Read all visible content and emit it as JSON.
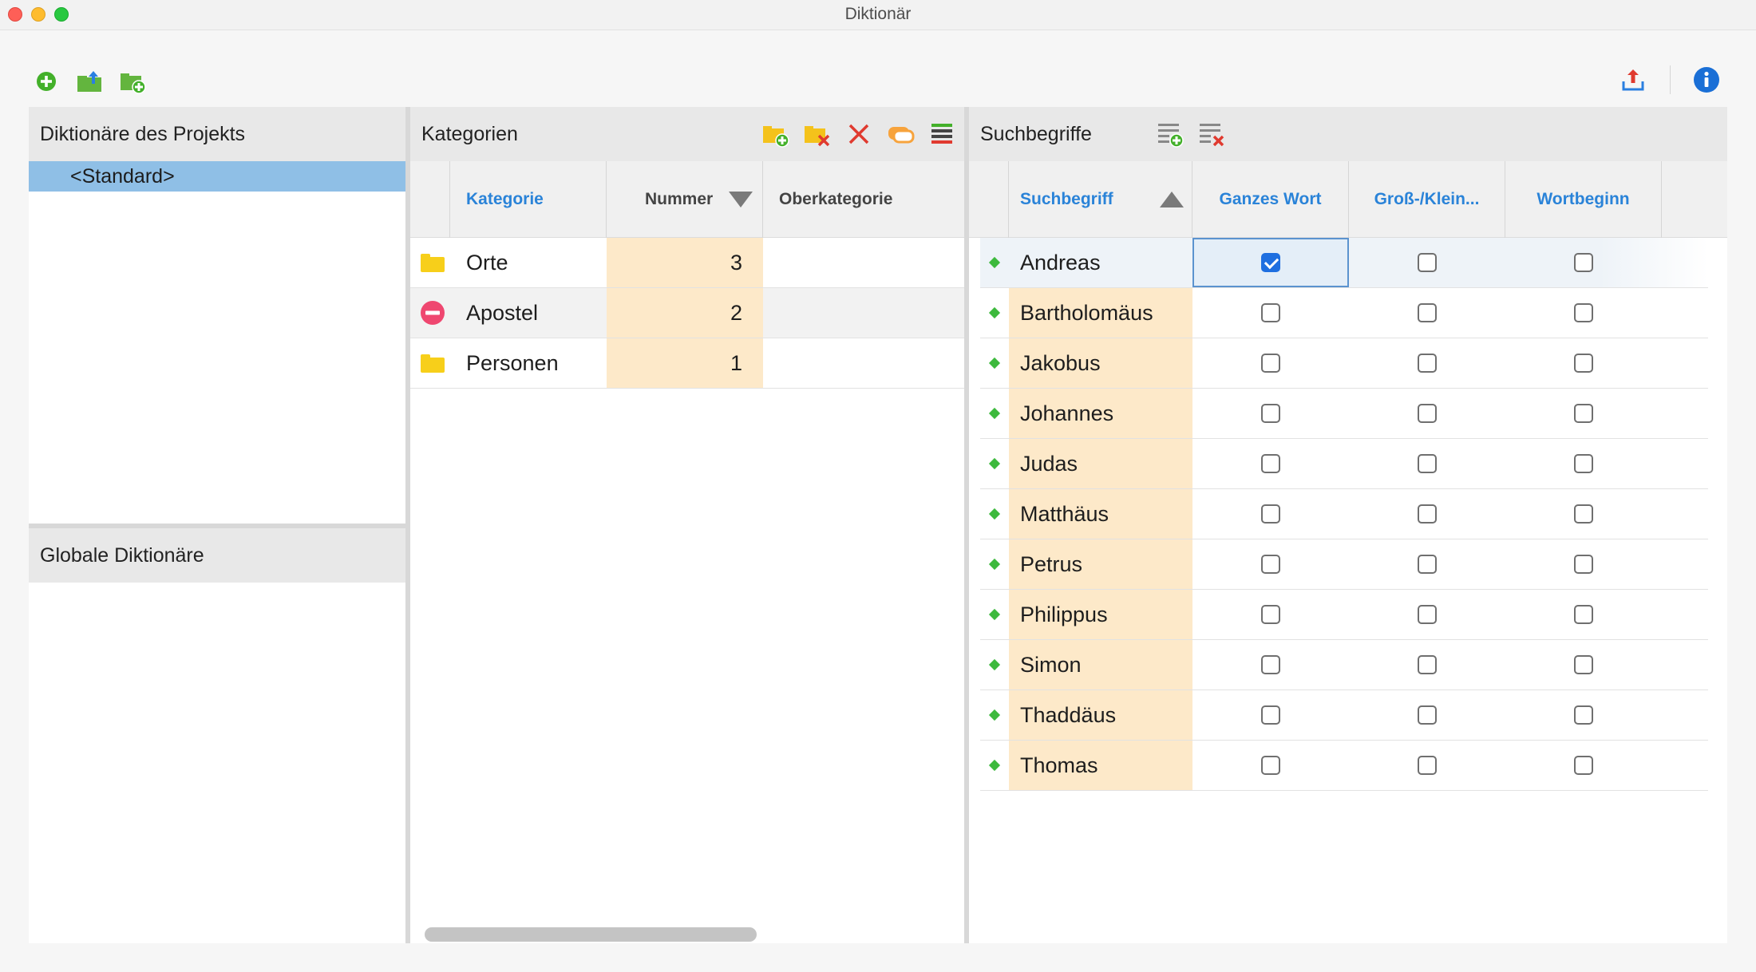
{
  "window": {
    "title": "Diktionär"
  },
  "toolbar": {
    "icons": [
      "add-dictionary-icon",
      "import-dictionary-icon",
      "new-folder-dictionary-icon",
      "export-icon",
      "info-icon"
    ],
    "colors": {
      "green": "#43b02a",
      "blue": "#1a6fd6",
      "red": "#e03a2f"
    }
  },
  "project_dicts": {
    "title": "Diktionäre des Projekts",
    "items": [
      "<Standard>"
    ]
  },
  "global_dicts": {
    "title": "Globale Diktionäre"
  },
  "categories": {
    "title": "Kategorien",
    "columns": {
      "kategorie": "Kategorie",
      "nummer": "Nummer",
      "oberkategorie": "Oberkategorie"
    },
    "rows": [
      {
        "icon": "folder-icon",
        "name": "Orte",
        "nummer": "3",
        "parent": ""
      },
      {
        "icon": "remove-circle-icon",
        "name": "Apostel",
        "nummer": "2",
        "parent": ""
      },
      {
        "icon": "folder-icon",
        "name": "Personen",
        "nummer": "1",
        "parent": ""
      }
    ]
  },
  "terms": {
    "title": "Suchbegriffe",
    "columns": {
      "term": "Suchbegriff",
      "whole": "Ganzes Wort",
      "case": "Groß-/Klein...",
      "start": "Wortbeginn"
    },
    "rows": [
      {
        "term": "Andreas",
        "whole": true,
        "case": false,
        "start": false
      },
      {
        "term": "Bartholomäus",
        "whole": false,
        "case": false,
        "start": false
      },
      {
        "term": "Jakobus",
        "whole": false,
        "case": false,
        "start": false
      },
      {
        "term": "Johannes",
        "whole": false,
        "case": false,
        "start": false
      },
      {
        "term": "Judas",
        "whole": false,
        "case": false,
        "start": false
      },
      {
        "term": "Matthäus",
        "whole": false,
        "case": false,
        "start": false
      },
      {
        "term": "Petrus",
        "whole": false,
        "case": false,
        "start": false
      },
      {
        "term": "Philippus",
        "whole": false,
        "case": false,
        "start": false
      },
      {
        "term": "Simon",
        "whole": false,
        "case": false,
        "start": false
      },
      {
        "term": "Thaddäus",
        "whole": false,
        "case": false,
        "start": false
      },
      {
        "term": "Thomas",
        "whole": false,
        "case": false,
        "start": false
      }
    ]
  }
}
